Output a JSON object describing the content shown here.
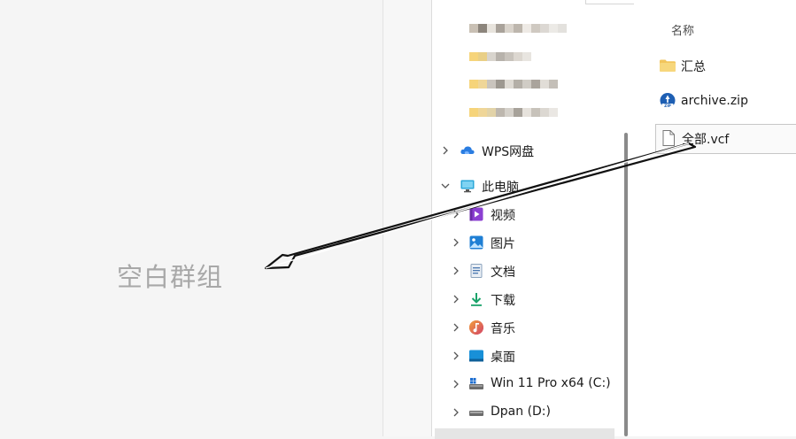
{
  "chat": {
    "empty_group_label": "空白群组"
  },
  "nav": {
    "items": [
      {
        "label": "WPS网盘",
        "icon": "cloud-icon",
        "expanded": false
      },
      {
        "label": "此电脑",
        "icon": "monitor-icon",
        "expanded": true
      },
      {
        "label": "视频",
        "icon": "video-icon",
        "expanded": false
      },
      {
        "label": "图片",
        "icon": "picture-icon",
        "expanded": false
      },
      {
        "label": "文档",
        "icon": "document-icon",
        "expanded": false
      },
      {
        "label": "下载",
        "icon": "download-icon",
        "expanded": false
      },
      {
        "label": "音乐",
        "icon": "music-icon",
        "expanded": false
      },
      {
        "label": "桌面",
        "icon": "desktop-icon",
        "expanded": false
      },
      {
        "label": "Win 11 Pro x64 (C:)",
        "icon": "drive-c-icon",
        "expanded": false
      },
      {
        "label": "Dpan (D:)",
        "icon": "drive-d-icon",
        "expanded": false
      }
    ]
  },
  "files": {
    "column_name": "名称",
    "items": [
      {
        "label": "汇总",
        "icon": "folder-icon"
      },
      {
        "label": "archive.zip",
        "icon": "zip-icon"
      },
      {
        "label": "全部.vcf",
        "icon": "file-icon",
        "selected": true
      }
    ]
  },
  "colors": {
    "accent": "#0067c0",
    "folder": "#f2c55c",
    "selection": "#e5e5e5"
  }
}
